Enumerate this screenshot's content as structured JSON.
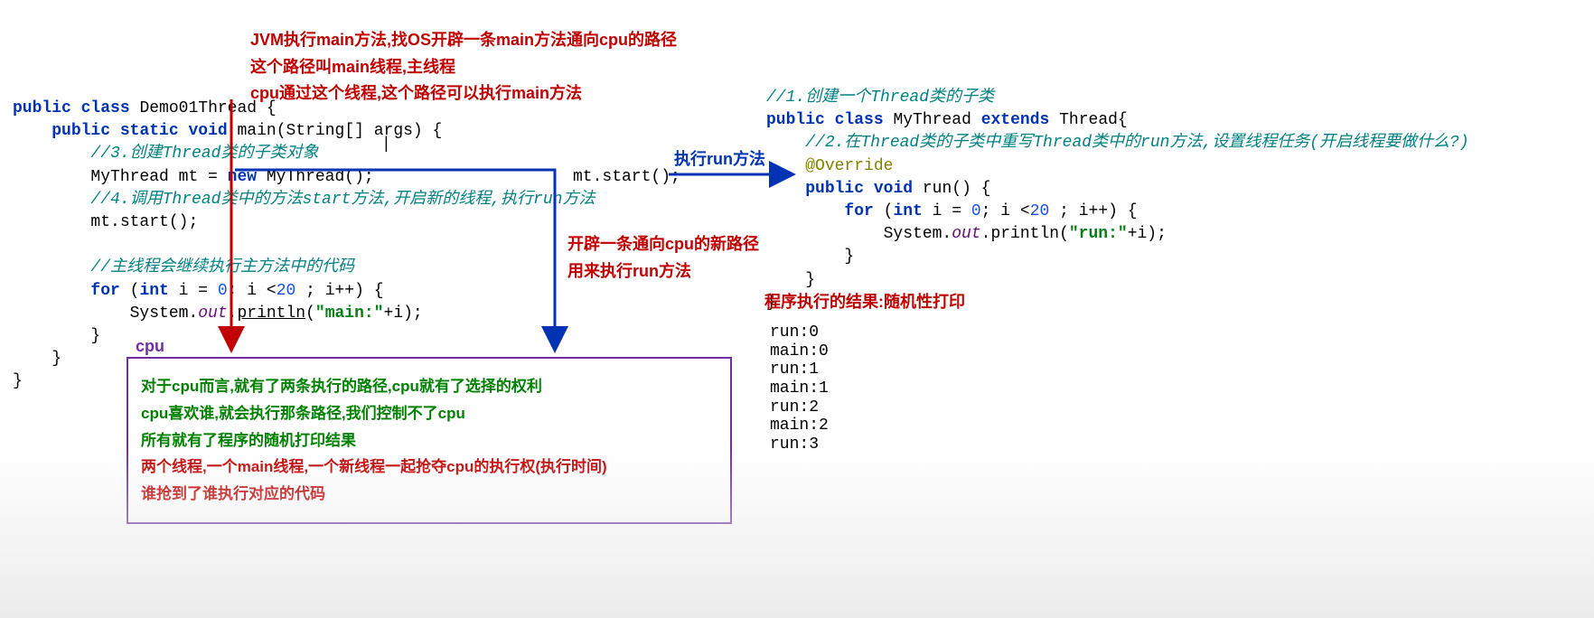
{
  "top_red": {
    "l1": "JVM执行main方法,找OS开辟一条main方法通向cpu的路径",
    "l2": "这个路径叫main线程,主线程",
    "l3": "cpu通过这个线程,这个路径可以执行main方法"
  },
  "code_left": {
    "l1a": "public",
    "l1b": "class",
    "l1c": "Demo01Thread",
    "l1d": "{",
    "l2a": "public",
    "l2b": "static",
    "l2c": "void",
    "l2d": "main(String[] args) {",
    "l3": "//3.创建Thread类的子类对象",
    "l4a": "MyThread mt = ",
    "l4b": "new",
    "l4c": " MyThread();",
    "l5": "//4.调用Thread类中的方法start方法,开启新的线程,执行run方法",
    "l6": "mt.start();",
    "l7": "//主线程会继续执行主方法中的代码",
    "l8a": "for",
    "l8b": " (",
    "l8c": "int",
    "l8d": " i = ",
    "l8e": "0",
    "l8f": "; i <",
    "l8g": "20",
    "l8h": " ; i++) {",
    "l9a": "System.",
    "l9b": "out",
    "l9c": ".",
    "l9d": "println",
    "l9e": "(",
    "l9f": "\"main:\"",
    "l9g": "+i);",
    "l10": "}",
    "l11": "}",
    "l12": "}"
  },
  "mt_start": "mt.start();",
  "mid_red": {
    "l1": "开辟一条通向cpu的新路径",
    "l2": "用来执行run方法"
  },
  "run_label": "执行run方法",
  "code_right": {
    "l1": "//1.创建一个Thread类的子类",
    "l2a": "public",
    "l2b": "class",
    "l2c": "MyThread",
    "l2d": "extends",
    "l2e": "Thread{",
    "l3": "//2.在Thread类的子类中重写Thread类中的run方法,设置线程任务(开启线程要做什么?)",
    "l4": "@Override",
    "l5a": "public",
    "l5b": "void",
    "l5c": "run() {",
    "l6a": "for",
    "l6b": " (",
    "l6c": "int",
    "l6d": " i = ",
    "l6e": "0",
    "l6f": "; i <",
    "l6g": "20",
    "l6h": " ; i++) {",
    "l7a": "System.",
    "l7b": "out",
    "l7c": ".println(",
    "l7d": "\"run:\"",
    "l7e": "+i);",
    "l8": "}",
    "l9": "}",
    "l10": "}"
  },
  "result_label": "程序执行的结果:随机性打印",
  "output": {
    "l1": "run:0",
    "l2": "main:0",
    "l3": "run:1",
    "l4": "main:1",
    "l5": "run:2",
    "l6": "main:2",
    "l7": "run:3"
  },
  "cpu_label": "cpu",
  "cpu_box": {
    "l1": "对于cpu而言,就有了两条执行的路径,cpu就有了选择的权利",
    "l2": "cpu喜欢谁,就会执行那条路径,我们控制不了cpu",
    "l3": "所有就有了程序的随机打印结果",
    "l4": "两个线程,一个main线程,一个新线程一起抢夺cpu的执行权(执行时间)",
    "l5": "谁抢到了谁执行对应的代码"
  }
}
